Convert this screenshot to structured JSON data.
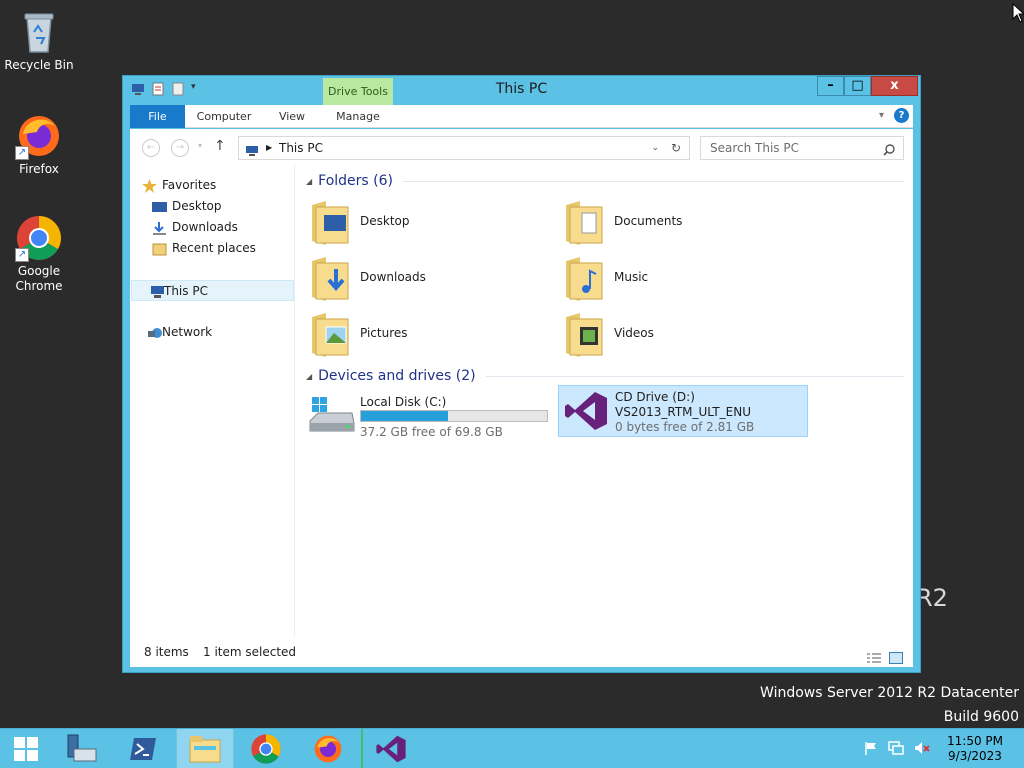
{
  "desktop": {
    "icons": [
      {
        "label": "Recycle Bin",
        "icon": "recycle-bin-icon"
      },
      {
        "label": "Firefox",
        "icon": "firefox-icon"
      },
      {
        "label": "Google Chrome",
        "icon": "chrome-icon"
      }
    ],
    "watermark_fragment": "R2",
    "os_edition": "Windows Server 2012 R2 Datacenter",
    "os_build": "Build 9600"
  },
  "window": {
    "title": "This PC",
    "context_tab": "Drive Tools",
    "ribbon_tabs": [
      "File",
      "Computer",
      "View",
      "Manage"
    ],
    "address": "This PC",
    "search_placeholder": "Search This PC",
    "controls": {
      "minimize": "–",
      "maximize": "□",
      "close": "x"
    }
  },
  "nav_pane": {
    "favorites": "Favorites",
    "favorites_items": [
      "Desktop",
      "Downloads",
      "Recent places"
    ],
    "this_pc": "This PC",
    "network": "Network"
  },
  "folders": {
    "header": "Folders (6)",
    "items": [
      {
        "name": "Desktop",
        "overlay": "desktop"
      },
      {
        "name": "Documents",
        "overlay": "documents"
      },
      {
        "name": "Downloads",
        "overlay": "downloads"
      },
      {
        "name": "Music",
        "overlay": "music"
      },
      {
        "name": "Pictures",
        "overlay": "pictures"
      },
      {
        "name": "Videos",
        "overlay": "videos"
      }
    ]
  },
  "devices": {
    "header": "Devices and drives (2)",
    "items": [
      {
        "name": "Local Disk (C:)",
        "free": "37.2 GB free of 69.8 GB",
        "used_fraction": 0.467,
        "selected": false
      },
      {
        "name": "CD Drive (D:)",
        "sub": "VS2013_RTM_ULT_ENU",
        "free": "0 bytes free of 2.81 GB",
        "selected": true
      }
    ]
  },
  "status": {
    "items": "8 items",
    "selected": "1 item selected"
  },
  "taskbar": {
    "buttons": [
      "start-button",
      "server-manager",
      "powershell",
      "file-explorer",
      "chrome",
      "firefox",
      "visual-studio"
    ],
    "time": "11:50 PM",
    "date": "9/3/2023"
  },
  "colors": {
    "accent": "#5bc2e6",
    "file_tab": "#1979ca",
    "drive_tools": "#b9e8a1",
    "selection": "#cce8ff",
    "close": "#c74b44"
  }
}
